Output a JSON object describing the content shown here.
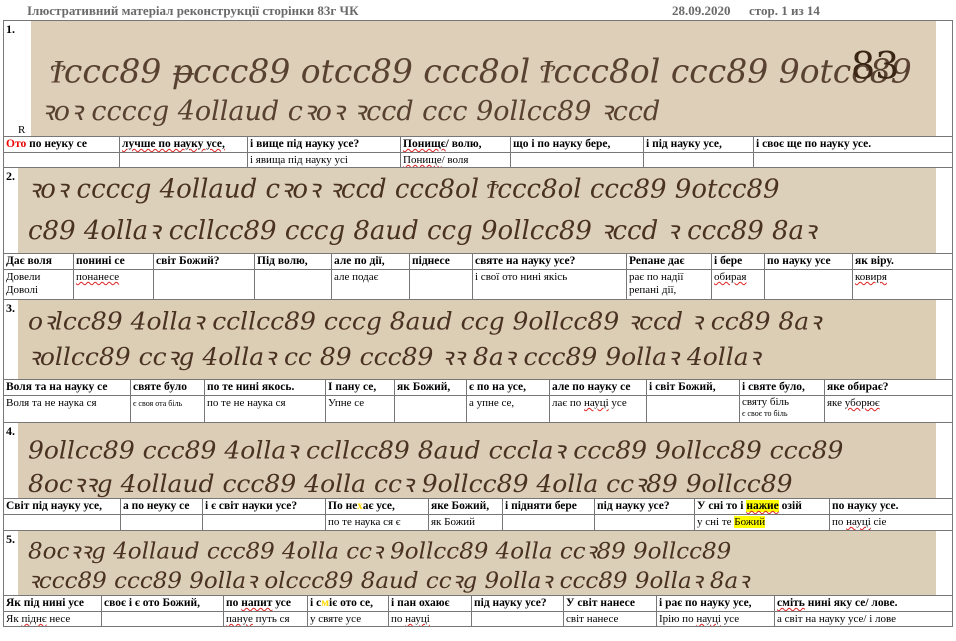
{
  "header": {
    "title": "Ілюстративний матеріал  реконструкції сторінки 83г ЧК",
    "date": "28.09.2020",
    "page": "стор. 1 из 14"
  },
  "page_number_on_scan": "83",
  "row_marker": "R",
  "rows": [
    {
      "num": "1.",
      "top": [
        {
          "t": "Ото по неуку се",
          "red_prefix": "Ото",
          "rest": " по неуку се"
        },
        {
          "t": "лучше по науку усе,",
          "wavy": true
        },
        {
          "t": "і вище під науку усе?"
        },
        {
          "t": "Понищє/ волю,",
          "wavy_prefix": "Понищє"
        },
        {
          "t": "що і по науку бере,"
        },
        {
          "t": "і під науку усе,"
        },
        {
          "t": "і своє ще по науку усе."
        }
      ],
      "bottom": [
        {
          "t": ""
        },
        {
          "t": ""
        },
        {
          "t": "і явища під науку усі"
        },
        {
          "t": "Понище/ воля",
          "wavy_prefix": "Понище"
        },
        {
          "t": ""
        },
        {
          "t": ""
        },
        {
          "t": ""
        }
      ]
    },
    {
      "num": "2.",
      "top": [
        {
          "t": "Дає воля"
        },
        {
          "t": "понині се"
        },
        {
          "t": "світ Божий?"
        },
        {
          "t": "Під волю,"
        },
        {
          "t": "але по дії,"
        },
        {
          "t": "піднесе"
        },
        {
          "t": "святе на науку усе?"
        },
        {
          "t": "Репане дає"
        },
        {
          "t": "і бере"
        },
        {
          "t": "по науку усе"
        },
        {
          "t": "як віру."
        }
      ],
      "bottom": [
        {
          "t": "Довели\nДоволі"
        },
        {
          "t": "понанесе",
          "wavy": true
        },
        {
          "t": ""
        },
        {
          "t": ""
        },
        {
          "t": "але подає"
        },
        {
          "t": ""
        },
        {
          "t": "і свої ото нині якісь"
        },
        {
          "t": "рає по надії\nрепані дії,"
        },
        {
          "t": "обирая",
          "wavy": true
        },
        {
          "t": ""
        },
        {
          "t": "ковиря",
          "wavy": true
        }
      ]
    },
    {
      "num": "3.",
      "top": [
        {
          "t": "Воля та на науку се"
        },
        {
          "t": "святе було"
        },
        {
          "t": "по те нині якось."
        },
        {
          "t": "І пану се,"
        },
        {
          "t": "як Божий,"
        },
        {
          "t": "є по на усе,"
        },
        {
          "t": "але по науку се"
        },
        {
          "t": "і світ Божий,"
        },
        {
          "t": "і святе було,"
        },
        {
          "t": "яке обирає?"
        }
      ],
      "bottom": [
        {
          "t": "Воля та не наука ся"
        },
        {
          "t": "є своя ота біль",
          "small": true
        },
        {
          "t": "по те не наука ся"
        },
        {
          "t": "Упне се"
        },
        {
          "t": ""
        },
        {
          "t": "а упне се,"
        },
        {
          "t": "лає по науці усе",
          "wavy_word": "науці"
        },
        {
          "t": ""
        },
        {
          "t": "святу біль\nє своє то біль",
          "small_second": true
        },
        {
          "t": "яке уборює",
          "wavy_word": "уборює"
        }
      ]
    },
    {
      "num": "4.",
      "top": [
        {
          "t": "Світ під науку усе,"
        },
        {
          "t": "а по неуку се"
        },
        {
          "t": "і є світ науки усе?"
        },
        {
          "t": "По не хає усе,"
        },
        {
          "t": "яке Божий,"
        },
        {
          "t": "і підняти бере"
        },
        {
          "t": "під науку усе?"
        },
        {
          "t": "У сні то і нажие озій",
          "hl_word": "нажие"
        },
        {
          "t": "по науку усе."
        }
      ],
      "bottom": [
        {
          "t": ""
        },
        {
          "t": ""
        },
        {
          "t": ""
        },
        {
          "t": "по те наука ся є"
        },
        {
          "t": "як Божий"
        },
        {
          "t": ""
        },
        {
          "t": ""
        },
        {
          "t": "у сні те Божий",
          "hl_word": "Божий"
        },
        {
          "t": "по науці сіе",
          "wavy_word": "науці"
        }
      ]
    },
    {
      "num": "5.",
      "top": [
        {
          "t": "Як під нині усе"
        },
        {
          "t": "своє і є ото Божий,"
        },
        {
          "t": "по напит усе",
          "wavy_word": "напит"
        },
        {
          "t": "і сміє ото се,"
        },
        {
          "t": "і пан охаює"
        },
        {
          "t": "під науку усе?"
        },
        {
          "t": "У світ нанесе"
        },
        {
          "t": "і рає по науку усе,"
        },
        {
          "t": "сміть нині яку се/ лове.",
          "wavy_word": "сміть"
        }
      ],
      "bottom": [
        {
          "t": "Як піднє несе",
          "wavy_word": "піднє"
        },
        {
          "t": ""
        },
        {
          "t": "пануе путь ся",
          "wavy_word": "пануе"
        },
        {
          "t": "у святе усе"
        },
        {
          "t": "по науці",
          "wavy_word": "науці"
        },
        {
          "t": ""
        },
        {
          "t": "світ нанесе"
        },
        {
          "t": "Ірію по науці усе",
          "wavy_word": "науці"
        },
        {
          "t": "а світ на науку усе/ і лове"
        }
      ]
    }
  ]
}
